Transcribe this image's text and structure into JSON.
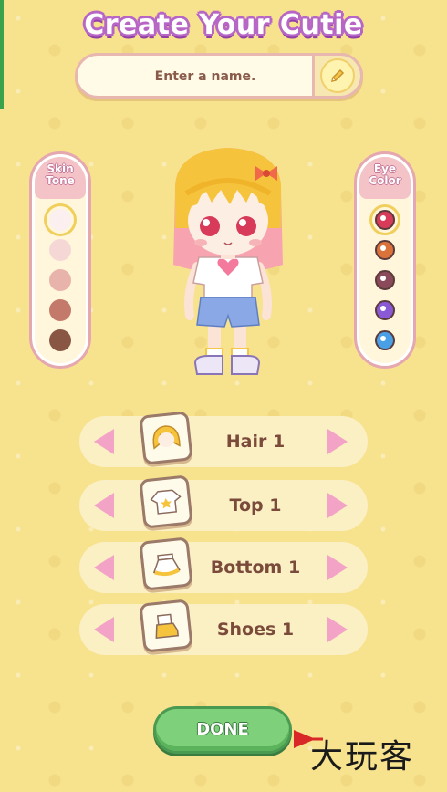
{
  "title": "Create Your Cutie",
  "name_field": {
    "placeholder": "Enter a name.",
    "value": ""
  },
  "skin_tone": {
    "title_line1": "Skin",
    "title_line2": "Tone",
    "swatches": [
      "#fbeff0",
      "#f5d8d6",
      "#e8b3aa",
      "#c47a6a",
      "#8a5644"
    ],
    "selected_index": 0
  },
  "eye_color": {
    "title_line1": "Eye",
    "title_line2": "Color",
    "options": [
      "#d83a5a",
      "#d9733a",
      "#8a4a5a",
      "#8a5ad6",
      "#4aa0e6"
    ],
    "selected_index": 0
  },
  "selectors": [
    {
      "label": "Hair 1",
      "icon": "hair-icon"
    },
    {
      "label": "Top 1",
      "icon": "shirt-icon"
    },
    {
      "label": "Bottom 1",
      "icon": "skirt-icon"
    },
    {
      "label": "Shoes 1",
      "icon": "shoe-icon"
    }
  ],
  "done_label": "DONE",
  "watermark_text": "大玩客",
  "colors": {
    "background": "#f7e28e",
    "arrow": "#f3a3c6",
    "done_green": "#7fd07a",
    "title_outline": "#b766c6"
  }
}
